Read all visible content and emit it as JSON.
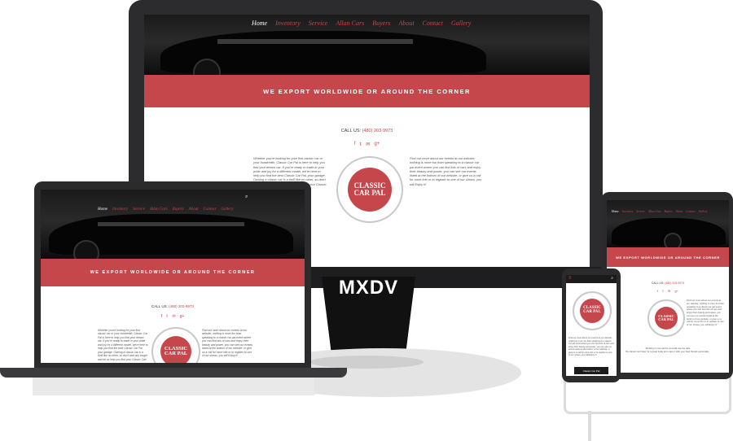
{
  "brand": {
    "stand_label": "MXDV"
  },
  "site": {
    "nav": [
      "Home",
      "Inventory",
      "Service",
      "Allan Cars",
      "Buyers",
      "About",
      "Contact",
      "Gallery"
    ],
    "banner": "WE EXPORT WORLDWIDE OR AROUND THE CORNER",
    "call_prefix": "CALL US:",
    "phone": "(480) 203-9973",
    "social_icons": [
      "facebook-icon",
      "twitter-icon",
      "email-icon",
      "google-plus-icon"
    ],
    "social_glyphs": [
      "f",
      "𝕥",
      "✉",
      "g+"
    ],
    "para_left": "Whether you're looking for your first classic car or your hundredth, Classic Car Pal is here to help you find your dream car. If you're ready to trade in your pride and joy for a different model, we're here to help you find the best Classic Car Pal, your garage. Owning a classic car is a thrill like no other, so don't wait any longer and let us help you find your Classic Car!",
    "para_right": "Find out more about our events at our website; nothing is more fun than speaking to a classic car pal event where you can find lots of cars and enjoy their beauty and power, you can see our events listed at the bottom of our website, or give us a call for more info or to register to one of our shows, you will Enjoy it!",
    "logo": {
      "line1": "CLASSIC",
      "line2": "CAR PAL"
    },
    "search_icon": "search-icon",
    "footer_line1": "Working on the call for emerald use the date",
    "footer_line2": "the classic car finder for a great trade and enjoy it with your best friends personally...",
    "chat_label": "Classic Car Pal"
  },
  "colors": {
    "accent": "#c5474c",
    "device": "#2b2b2d"
  }
}
